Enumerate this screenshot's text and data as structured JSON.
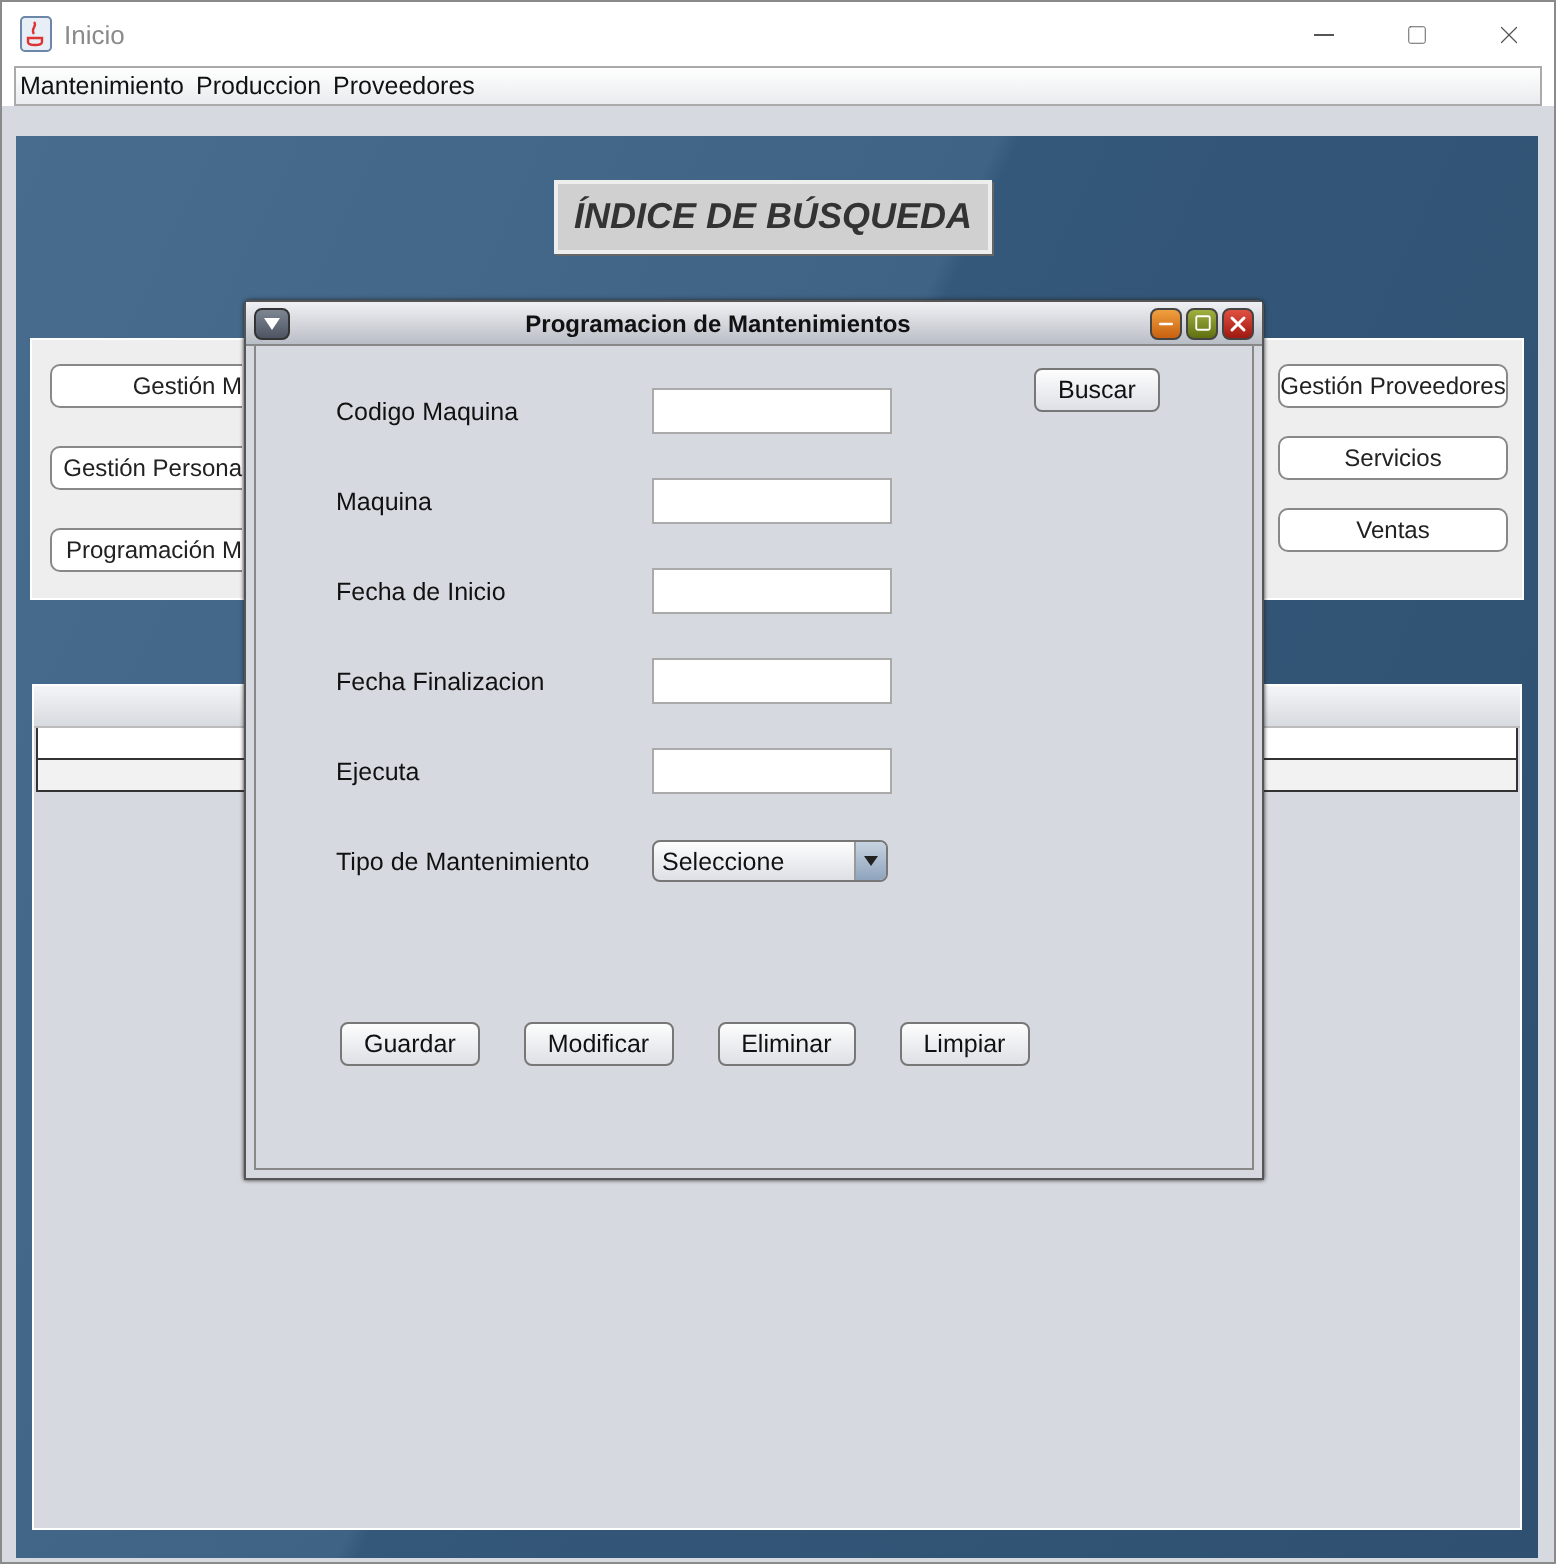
{
  "window": {
    "title": "Inicio"
  },
  "menu": [
    "Mantenimiento",
    "Produccion",
    "Proveedores"
  ],
  "desktop": {
    "heading": "ÍNDICE DE BÚSQUEDA",
    "left_buttons": [
      "Gestión M",
      "Gestión Persona",
      "Programación M"
    ],
    "right_buttons": [
      "Gestión Proveedores",
      "Servicios",
      "Ventas"
    ]
  },
  "internal_frame": {
    "title": "Programacion de Mantenimientos",
    "fields": [
      {
        "label": "Codigo Maquina",
        "kind": "text"
      },
      {
        "label": "Maquina",
        "kind": "text"
      },
      {
        "label": "Fecha de Inicio",
        "kind": "text"
      },
      {
        "label": "Fecha Finalizacion",
        "kind": "text"
      },
      {
        "label": "Ejecuta",
        "kind": "text"
      },
      {
        "label": "Tipo de Mantenimiento",
        "kind": "select",
        "value": "Seleccione"
      }
    ],
    "search_button": "Buscar",
    "buttons": [
      "Guardar",
      "Modificar",
      "Eliminar",
      "Limpiar"
    ]
  }
}
